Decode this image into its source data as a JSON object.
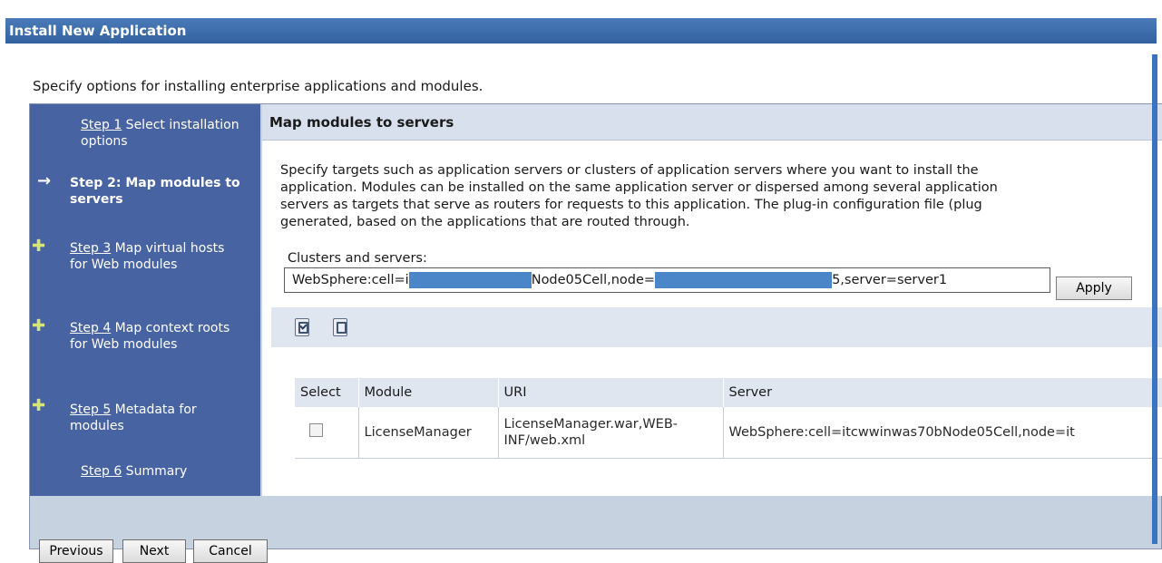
{
  "window": {
    "title": "Install New Application"
  },
  "intro": "Specify options for installing enterprise applications and modules.",
  "steps": [
    {
      "link": "Step 1",
      "text": " Select installation options"
    },
    {
      "text": "Step 2: Map modules to servers",
      "current": true
    },
    {
      "link": "Step 3",
      "text": " Map virtual hosts for Web modules"
    },
    {
      "link": "Step 4",
      "text": " Map context roots for Web modules"
    },
    {
      "link": "Step 5",
      "text": " Metadata for modules"
    },
    {
      "link": "Step 6",
      "text": " Summary"
    }
  ],
  "main": {
    "heading": "Map modules to servers",
    "description_lines": [
      "Specify targets such as application servers or clusters of application servers where you want to install the",
      "application. Modules can be installed on the same application server or dispersed among several application",
      "servers as targets that serve as routers for requests to this application. The plug-in configuration file (plug",
      "generated, based on the applications that are routed through."
    ],
    "clusters_label": "Clusters and servers:",
    "clusters_value": {
      "part1": "WebSphere:cell=i",
      "part2": "Node05Cell,node=",
      "part3": "5,server=server1"
    },
    "apply_label": "Apply"
  },
  "table": {
    "headers": [
      "Select",
      "Module",
      "URI",
      "Server"
    ],
    "rows": [
      {
        "module": "LicenseManager",
        "uri": "LicenseManager.war,WEB-INF/web.xml",
        "server": "WebSphere:cell=itcwwinwas70bNode05Cell,node=it"
      }
    ]
  },
  "footer": {
    "previous": "Previous",
    "next": "Next",
    "cancel": "Cancel"
  }
}
